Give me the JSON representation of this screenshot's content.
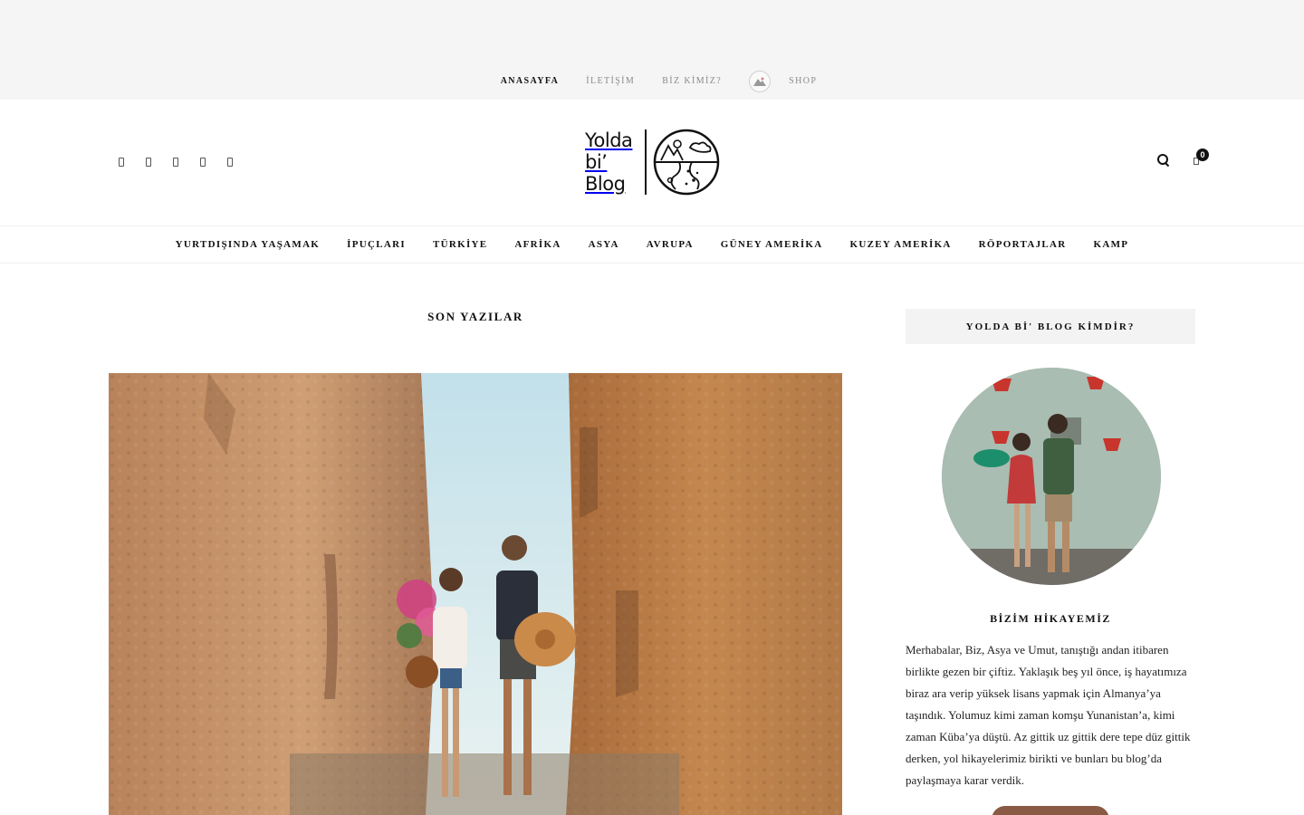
{
  "topnav": {
    "items": [
      {
        "label": "ANASAYFA",
        "active": true
      },
      {
        "label": "İLETİŞİM",
        "active": false
      },
      {
        "label": "BİZ KİMİZ?",
        "active": false
      }
    ],
    "shop_label": "SHOP"
  },
  "header": {
    "logo_lines": [
      "Yolda",
      "bi’",
      "Blog"
    ],
    "social_icons": [
      "facebook-icon",
      "twitter-icon",
      "instagram-icon",
      "pinterest-icon",
      "youtube-icon"
    ],
    "cart_count": "0"
  },
  "mainnav": {
    "items": [
      "YURTDIŞINDA YAŞAMAK",
      "İPUÇLARI",
      "TÜRKİYE",
      "AFRİKA",
      "ASYA",
      "AVRUPA",
      "GÜNEY AMERİKA",
      "KUZEY AMERİKA",
      "RÖPORTAJLAR",
      "KAMP"
    ]
  },
  "content": {
    "section_title": "SON YAZILAR"
  },
  "sidebar": {
    "widget_title": "YOLDA Bİ' BLOG KİMDİR?",
    "story_title": "BİZİM HİKAYEMİZ",
    "story_text": "Merhabalar, Biz, Asya ve Umut, tanıştığı andan itibaren birlikte gezen bir çiftiz. Yaklaşık beş yıl önce, iş hayatımıza biraz ara verip yüksek lisans yapmak için Almanya’ya taşındık. Yolumuz kimi zaman komşu Yunanistan’a, kimi zaman Küba’ya düştü. Az gittik uz gittik dere tepe düz gittik derken, yol hikayelerimiz birikti ve bunları bu blog’da paylaşmaya karar verdik."
  },
  "colors": {
    "topbar_bg": "#f5f5f5",
    "button_brown": "#8a5a44",
    "widget_bg": "#f3f3f3"
  }
}
